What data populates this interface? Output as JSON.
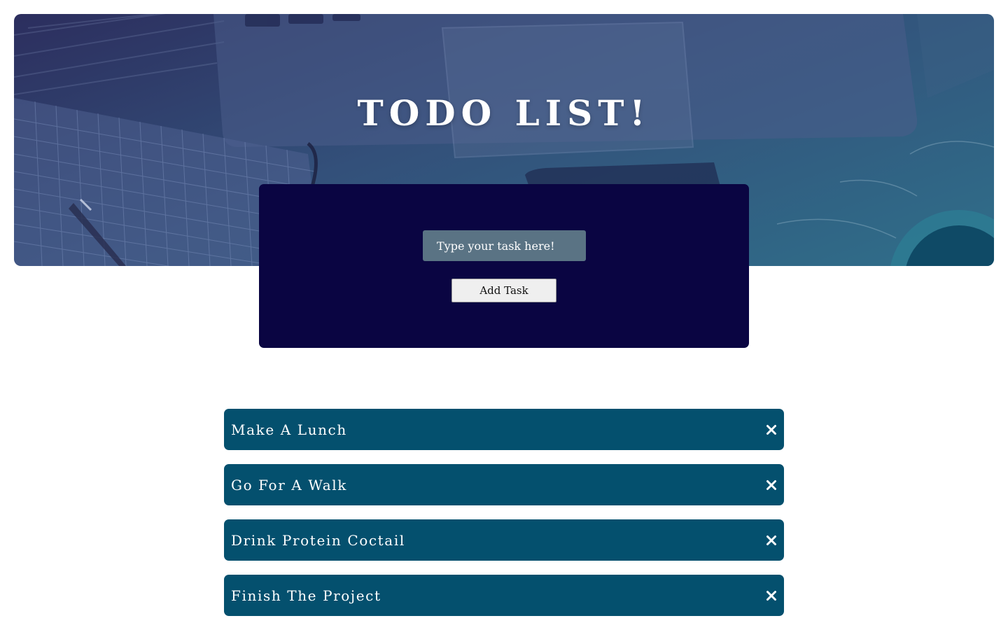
{
  "app": {
    "title": "TODO LIST!"
  },
  "form": {
    "input_placeholder": "Type your task here!",
    "add_label": "Add Task"
  },
  "tasks": [
    {
      "label": "Make A Lunch",
      "delete_icon": "close-icon"
    },
    {
      "label": "Go For A Walk",
      "delete_icon": "close-icon"
    },
    {
      "label": "Drink Protein Coctail",
      "delete_icon": "close-icon"
    },
    {
      "label": "Finish The Project",
      "delete_icon": "close-icon"
    }
  ],
  "colors": {
    "hero_overlay_start": "#2c2e5e",
    "hero_overlay_end": "#2f6f8a",
    "card_background": "#0a0542",
    "input_background": "#5a7384",
    "task_background": "#04506e",
    "text_light": "#ffffff"
  }
}
